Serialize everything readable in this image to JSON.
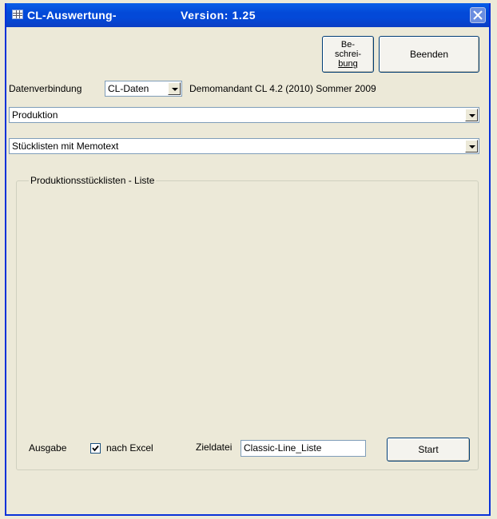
{
  "window": {
    "title": "CL-Auswertung-",
    "version": "Version: 1.25"
  },
  "toolbar": {
    "description_button_lines": [
      "Be-",
      "schrei-",
      "bung"
    ],
    "end_button": "Beenden"
  },
  "connection": {
    "label": "Datenverbindung",
    "selected": "CL-Daten",
    "info": "Demomandant CL 4.2 (2010) Sommer 2009"
  },
  "area_select": {
    "selected": "Produktion"
  },
  "report_select": {
    "selected": "Stücklisten mit Memotext"
  },
  "group": {
    "legend": "Produktionsstücklisten - Liste",
    "output_label": "Ausgabe",
    "excel_checkbox": {
      "label": "nach Excel",
      "checked": true
    },
    "target_label": "Zieldatei",
    "target_value": "Classic-Line_Liste",
    "start_button": "Start"
  }
}
